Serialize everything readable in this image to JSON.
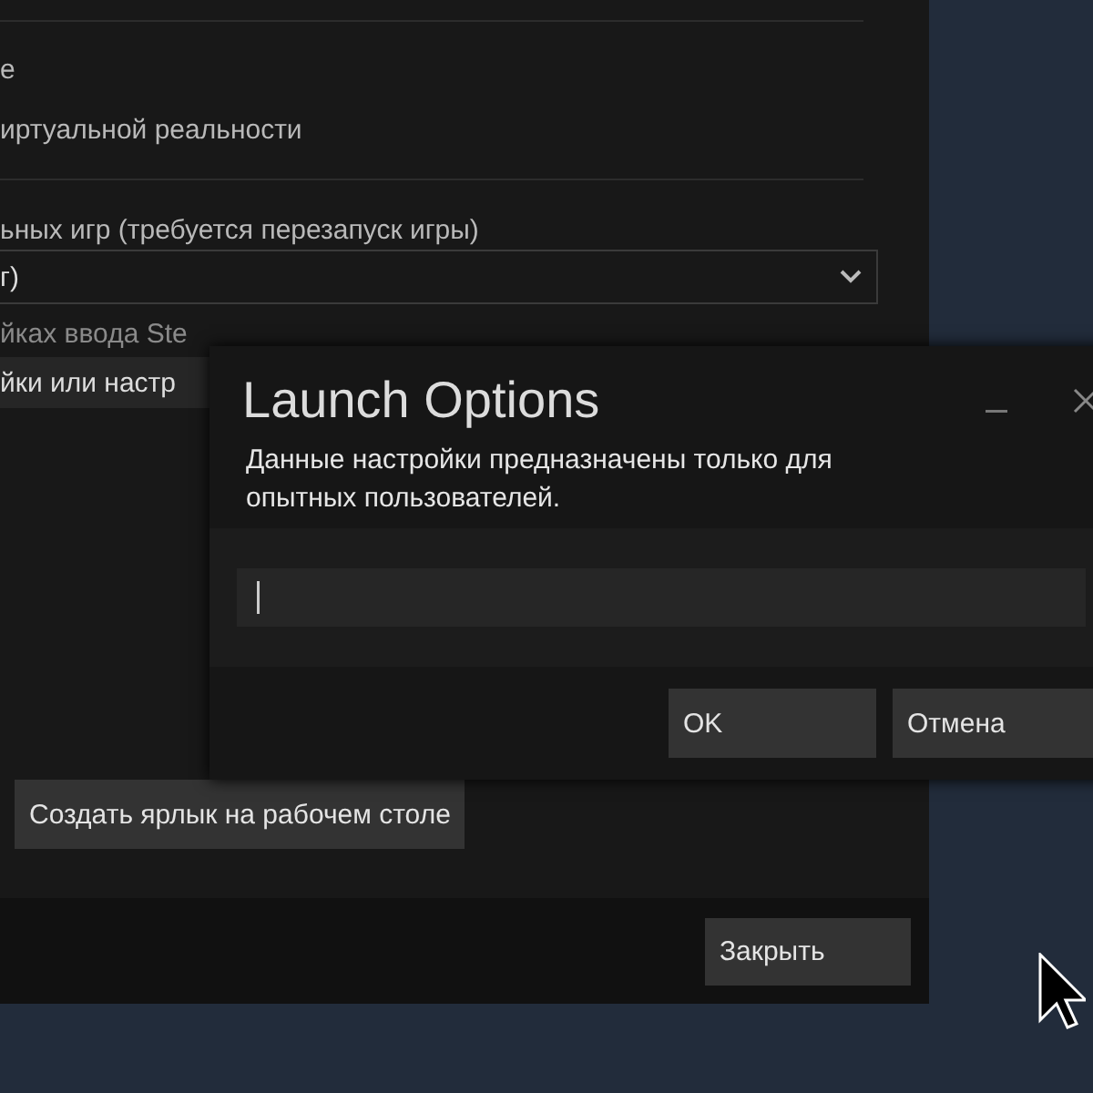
{
  "settings": {
    "item_1": "е",
    "item_2": "иртуальной реальности",
    "dropdown_label": "ьных игр (требуется перезапуск игры)",
    "dropdown_value": "г)",
    "input_label": "йках ввода Ste",
    "input_button": "йки или настр",
    "shortcut_button": "Создать ярлык на рабочем столе"
  },
  "footer": {
    "close_button": "Закрыть"
  },
  "dialog": {
    "title": "Launch Options",
    "description": "Данные настройки предназначены только для опытных пользователей.",
    "buttons": [
      "OK",
      "Отмена"
    ]
  }
}
